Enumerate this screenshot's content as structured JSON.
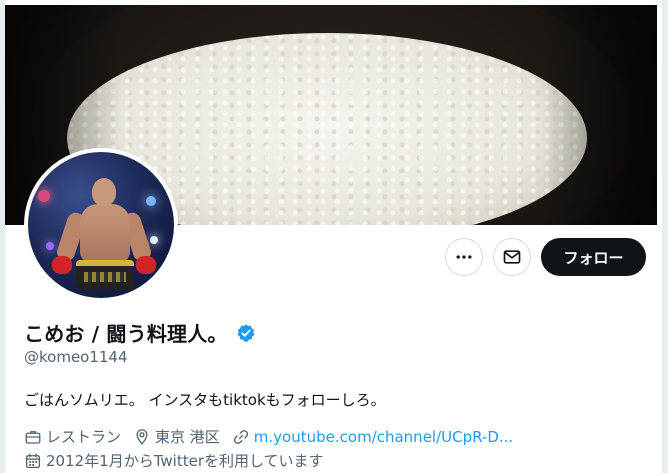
{
  "profile": {
    "display_name": "こめお / 闘う料理人。",
    "handle": "@komeo1144",
    "bio": "ごはんソムリエ。 インスタもtiktokもフォローしろ。",
    "category": "レストラン",
    "location": "東京 港区",
    "link_text": "m.youtube.com/channel/UCpR-D...",
    "joined": "2012年1月からTwitterを利用しています"
  },
  "actions": {
    "follow_label": "フォロー",
    "more_icon": "more-icon",
    "message_icon": "envelope-icon"
  },
  "colors": {
    "follow_bg": "#0f1419",
    "verified": "#1d9bf0",
    "link": "#1d9bf0",
    "muted": "#536471"
  }
}
